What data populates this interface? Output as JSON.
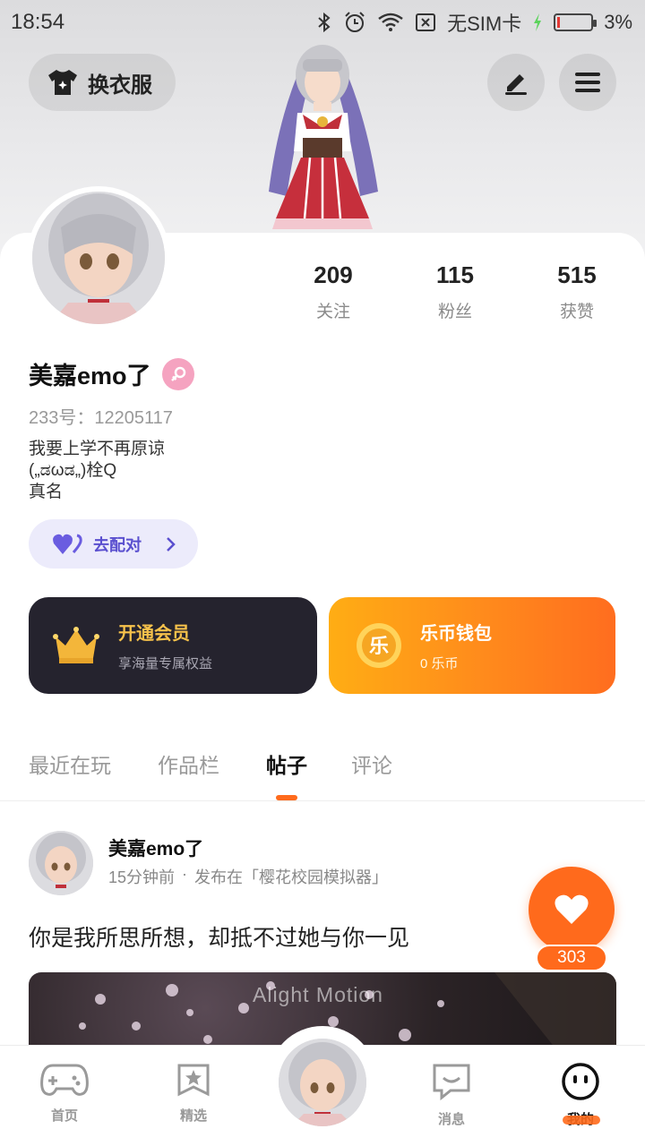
{
  "status_bar": {
    "time": "18:54",
    "sim": "无SIM卡",
    "battery": "3%",
    "icons": [
      "bluetooth-icon",
      "alarm-icon",
      "wifi-icon",
      "no-sim-icon",
      "charging-icon",
      "battery-icon"
    ]
  },
  "header": {
    "outfit_label": "换衣服",
    "icons": [
      "shirt-icon",
      "edit-icon",
      "menu-icon"
    ]
  },
  "profile": {
    "nickname": "美嘉emo了",
    "uid": "233号：12205117",
    "bio_lines": [
      "我要上学不再原谅",
      "(„ಡωಡ„)栓Q",
      "真名"
    ],
    "match_label": "去配对",
    "stats": [
      {
        "value": "209",
        "label": "关注"
      },
      {
        "value": "115",
        "label": "粉丝"
      },
      {
        "value": "515",
        "label": "获赞"
      }
    ]
  },
  "vip": {
    "title": "开通会员",
    "subtitle": "享海量专属权益"
  },
  "wallet": {
    "title": "乐币钱包",
    "subtitle": "0 乐币",
    "coin_char": "乐"
  },
  "tabs": [
    {
      "label": "最近在玩"
    },
    {
      "label": "作品栏"
    },
    {
      "label": "帖子"
    },
    {
      "label": "评论"
    }
  ],
  "post": {
    "author": "美嘉emo了",
    "time": "15分钟前",
    "separator": "·",
    "source": "发布在「樱花校园模拟器」",
    "text": "你是我所思所想，却抵不过她与你一见",
    "media_watermark": "Alight Motion",
    "like_count": "303"
  },
  "bottom_nav": [
    {
      "label": "首页"
    },
    {
      "label": "精选"
    },
    {
      "label": "消息"
    },
    {
      "label": "我的"
    }
  ],
  "colors": {
    "accent": "#ff6a1c",
    "vip_gold": "#f7c24b",
    "vip_bg": "#25232e",
    "match_purple": "#5a4fcf",
    "gender_pink": "#f5a3c0"
  }
}
